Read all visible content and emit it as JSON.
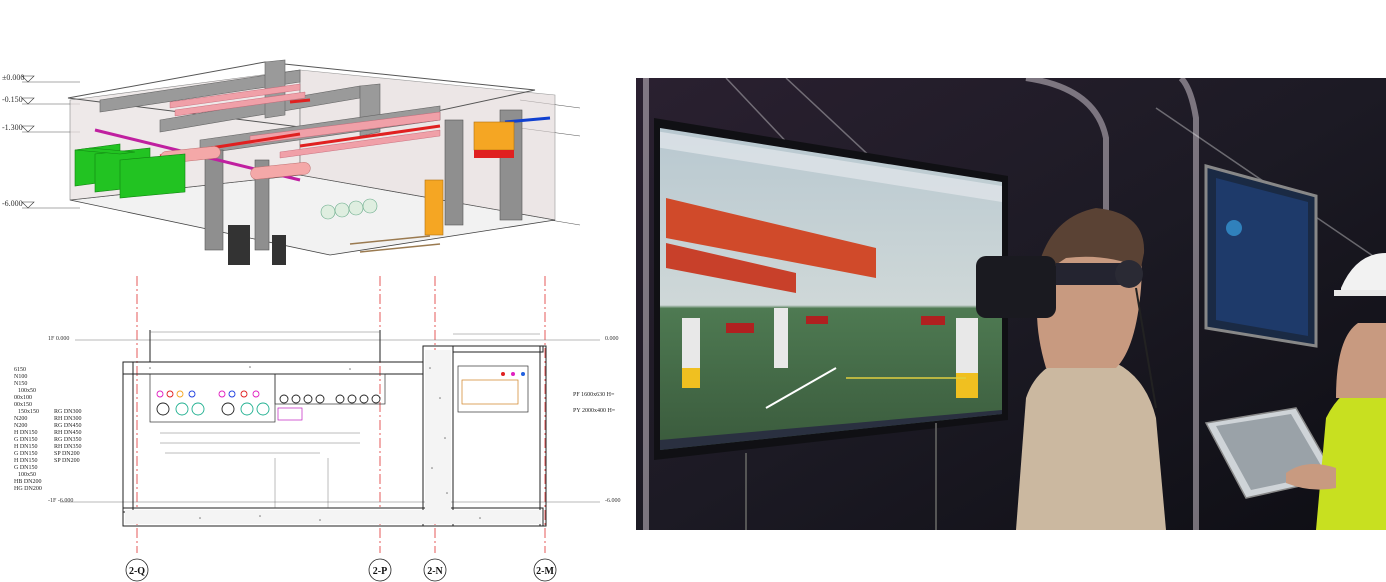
{
  "iso_view": {
    "level_labels": [
      "±0.000",
      "-0.150",
      "-1.300",
      "-6.000"
    ]
  },
  "section_view": {
    "level_top_left": "1F 0.000",
    "level_top_right": "0.000",
    "level_bottom_left": "-1F -6.000",
    "level_bottom_right": "-6.000",
    "left_notes": [
      "6150",
      "N100",
      "N150",
      "100x50",
      "00x100",
      "00x150",
      "150x150",
      "N200",
      "N200",
      "H DN150",
      "G DN150",
      "H DN150",
      "G DN150",
      "H DN150",
      "G DN150",
      "100x50",
      "HB DN200",
      "HG DN200"
    ],
    "mid_notes": [
      "RG DN300",
      "RH DN300",
      "RG DN450",
      "RH DN450",
      "RG DN350",
      "RH DN350",
      "SP DN200",
      "SP DN200"
    ],
    "right_notes": [
      "PF 1600x630 H=",
      "PY 2000x400 H="
    ],
    "grid_axes": [
      "2-Q",
      "2-P",
      "2-N",
      "2-M"
    ]
  },
  "colors": {
    "green_duct": "#22c322",
    "pink_pipe": "#f0a0a8",
    "red_pipe": "#e02020",
    "orange_unit": "#f5a623",
    "concrete": "#9a9a9a",
    "axis_red": "#e03030"
  }
}
